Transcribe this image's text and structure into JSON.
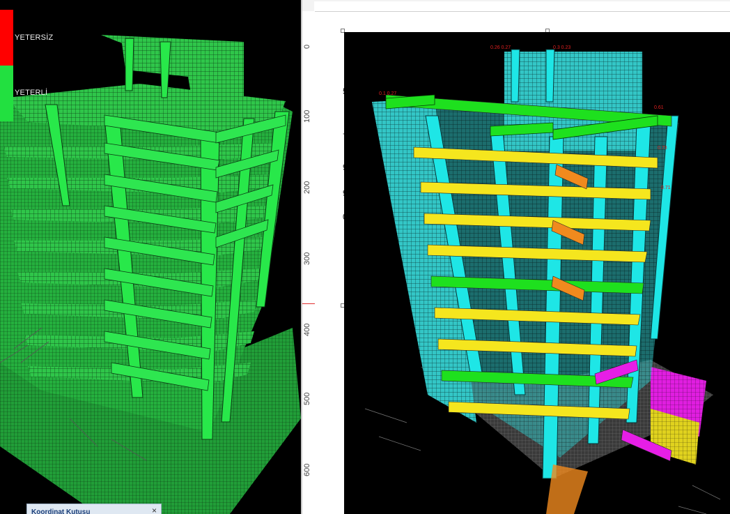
{
  "legend": {
    "items": [
      {
        "label": "YETERSİZ",
        "color": "#ff0000"
      },
      {
        "label": "YETERLİ",
        "color": "#22e040"
      }
    ]
  },
  "coord_panel": {
    "title": "Koordinat Kutusu",
    "close": "×"
  },
  "ruler": {
    "ticks": [
      "0",
      "100",
      "200",
      "300",
      "400",
      "500",
      "600"
    ]
  },
  "margin_numbers": [
    "50",
    "75",
    "90",
    "95",
    "00"
  ],
  "model_colors": {
    "adequate": "#22e040",
    "columns": "#19e6e6",
    "beams_ok": "#1ee01e",
    "beams_warn": "#f5e61e",
    "beams_orange": "#f08a1e",
    "beams_magenta": "#e61ee6"
  }
}
